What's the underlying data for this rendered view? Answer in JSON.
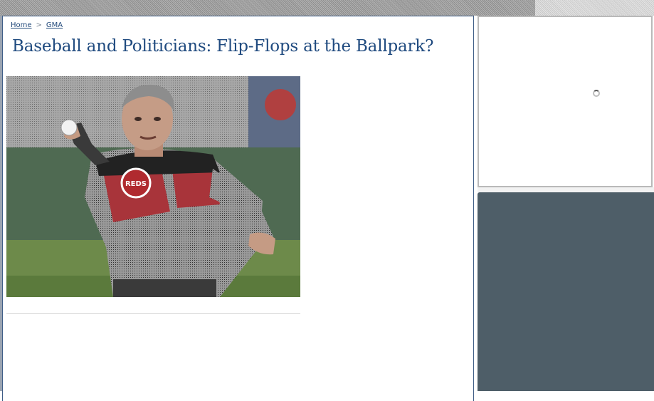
{
  "breadcrumb": {
    "items": [
      {
        "label": "Home"
      },
      {
        "label": "GMA"
      }
    ],
    "separator": ">"
  },
  "article": {
    "title": "Baseball and Politicians: Flip-Flops at the Ballpark?",
    "image": {
      "jersey_logo_text": "REDS"
    }
  },
  "sidebar": {
    "ad_loading": true
  },
  "colors": {
    "headline": "#1f4a7f",
    "link": "#234a7b",
    "panel_border": "#3f5d86",
    "right_panel": "#4e5e68"
  }
}
